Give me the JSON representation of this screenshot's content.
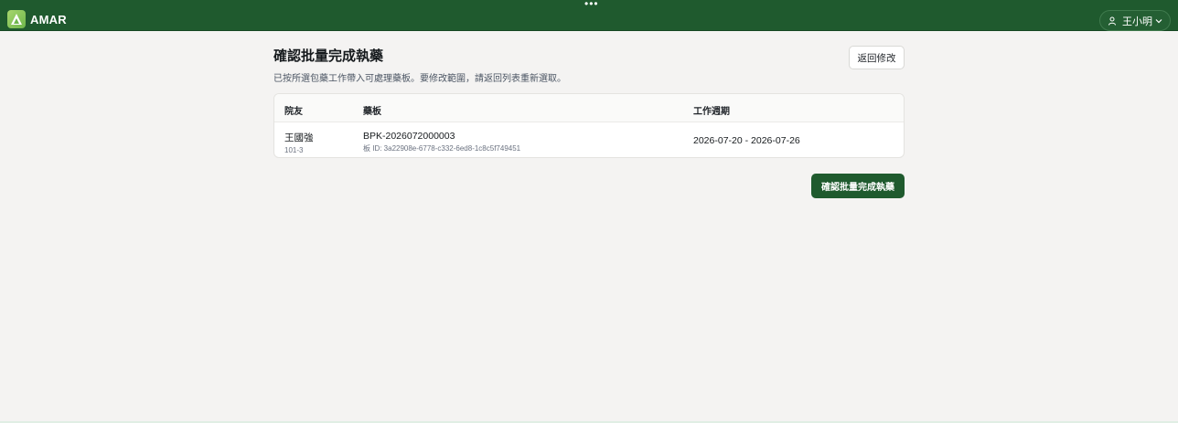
{
  "app": {
    "brand": "AMAR",
    "window_dots": "•••"
  },
  "user_menu": {
    "name": "王小明",
    "icon": "user-icon",
    "chevron": "chevron-down-icon"
  },
  "page": {
    "title": "確認批量完成執藥",
    "subtitle": "已按所選包藥工作帶入可處理藥板。要修改範圍，請返回列表重新選取。",
    "back_label": "返回修改",
    "confirm_label": "確認批量完成執藥"
  },
  "table": {
    "headers": [
      "院友",
      "藥板",
      "工作週期"
    ],
    "rows": [
      {
        "resident": "王國強",
        "bed": "101-3",
        "board": "BPK-2026072000003",
        "board_id": "板 ID: 3a22908e-6778-c332-6ed8-1c8c5f749451",
        "period": "2026-07-20 - 2026-07-26"
      }
    ]
  },
  "colors": {
    "primary": "#1f5a2e",
    "background": "#f4f3f2"
  }
}
